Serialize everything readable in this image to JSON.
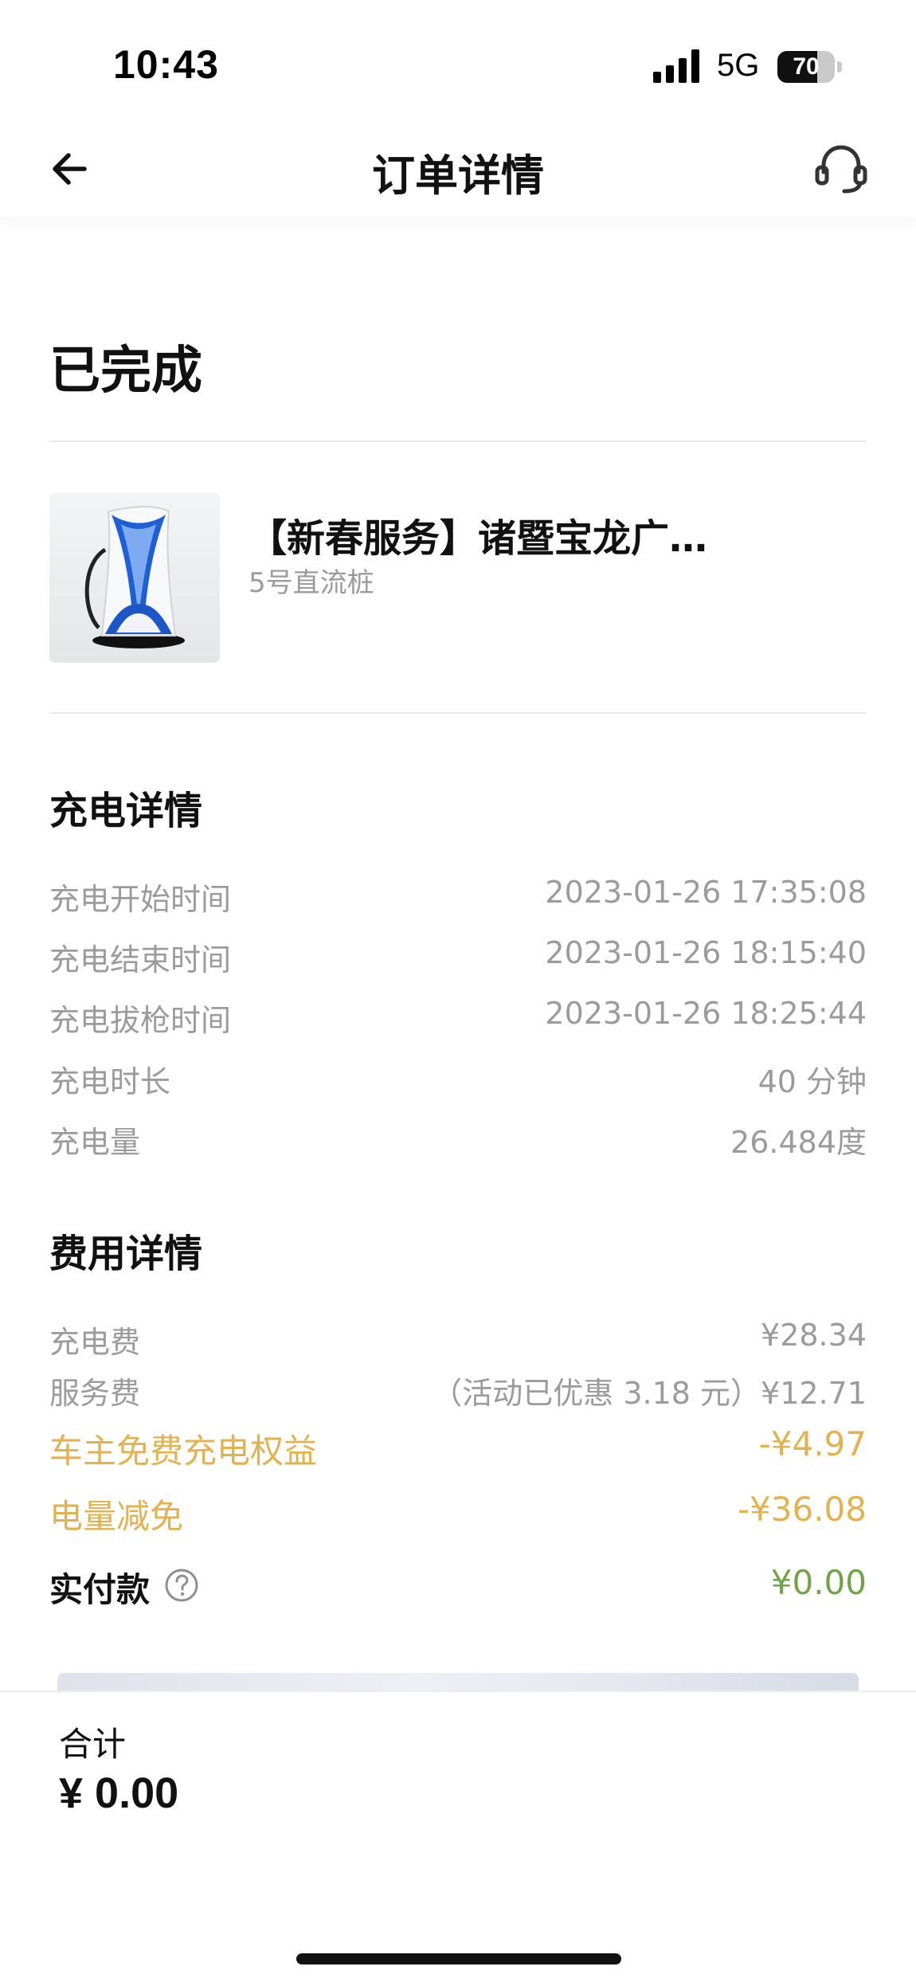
{
  "status_bar": {
    "time": "10:43",
    "network": "5G",
    "battery": "70",
    "battery_level": 0.7
  },
  "nav": {
    "title": "订单详情",
    "back_icon": "arrow-left-icon",
    "support_icon": "headset-icon"
  },
  "order": {
    "status": "已完成"
  },
  "station": {
    "name": "【新春服务】诸暨宝龙广…",
    "pile": "5号直流桩",
    "image": "charging-pile-image"
  },
  "charging_details": {
    "title": "充电详情",
    "rows": [
      {
        "label": "充电开始时间",
        "value": "2023-01-26 17:35:08"
      },
      {
        "label": "充电结束时间",
        "value": "2023-01-26 18:15:40"
      },
      {
        "label": "充电拔枪时间",
        "value": "2023-01-26 18:25:44"
      },
      {
        "label": "充电时长",
        "value": "40 分钟"
      },
      {
        "label": "充电量",
        "value": "26.484度"
      }
    ]
  },
  "fee_details": {
    "title": "费用详情",
    "rows": [
      {
        "label": "充电费",
        "value": "¥28.34"
      },
      {
        "label": "服务费",
        "value": "（活动已优惠 3.18 元）¥12.71"
      }
    ],
    "discounts": [
      {
        "label": "车主免费充电权益",
        "value": "-¥4.97"
      },
      {
        "label": "电量减免",
        "value": "-¥36.08"
      }
    ],
    "paid_label": "实付款",
    "paid_value": "¥0.00"
  },
  "footer": {
    "total_label": "合计",
    "total_value": "¥ 0.00"
  },
  "colors": {
    "discount": "#e2b24f",
    "paid": "#71a34a",
    "muted": "#9b9b9b",
    "text": "#111111"
  }
}
